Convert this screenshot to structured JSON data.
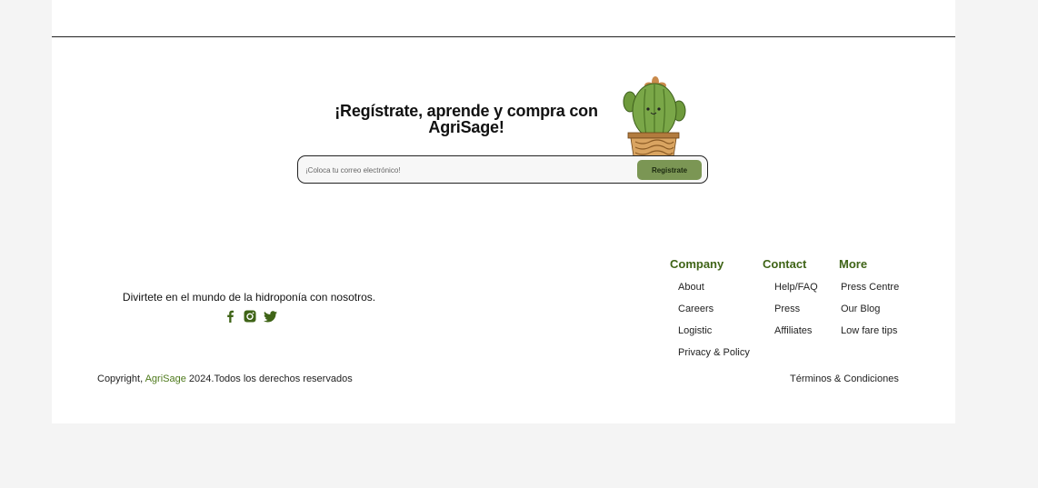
{
  "newsletter": {
    "title": "¡Regístrate, aprende y compra con AgriSage!",
    "email_placeholder": "¡Coloca tu correo electrónico!",
    "button_label": "Registrate"
  },
  "footer": {
    "tagline": "Divirtete en el mundo de la hidroponía con nosotros.",
    "socials": [
      "facebook-icon",
      "instagram-icon",
      "twitter-icon"
    ],
    "columns": {
      "company": {
        "title": "Company",
        "links": [
          "About",
          "Careers",
          "Logistic",
          "Privacy & Policy"
        ]
      },
      "contact": {
        "title": "Contact",
        "links": [
          "Help/FAQ",
          "Press",
          "Affiliates"
        ]
      },
      "more": {
        "title": "More",
        "links": [
          "Press Centre",
          "Our Blog",
          "Low fare tips"
        ]
      }
    },
    "copyright_prefix": "Copyright, ",
    "brand": "AgriSage",
    "copyright_suffix": " 2024.Todos los derechos reservados",
    "terms_label": "Términos & Condiciones"
  },
  "colors": {
    "brand_green": "#3f6417",
    "button_green": "#7b9654",
    "background": "#f4f4f4"
  }
}
